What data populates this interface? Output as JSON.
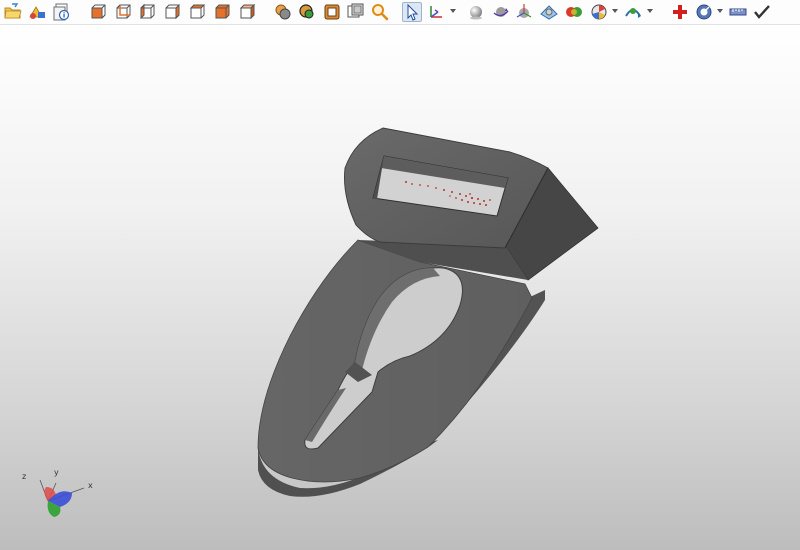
{
  "toolbar": {
    "buttons": [
      {
        "id": "open",
        "icon": "open-folder-icon"
      },
      {
        "id": "home",
        "icon": "home-shapes-icon"
      },
      {
        "id": "info",
        "icon": "info-document-icon"
      },
      {
        "id": "view-front",
        "icon": "view-front-icon"
      },
      {
        "id": "view-back",
        "icon": "view-back-icon"
      },
      {
        "id": "view-left",
        "icon": "view-left-icon"
      },
      {
        "id": "view-right",
        "icon": "view-right-icon"
      },
      {
        "id": "view-top",
        "icon": "view-top-icon"
      },
      {
        "id": "view-bottom",
        "icon": "view-bottom-icon"
      },
      {
        "id": "view-iso",
        "icon": "view-iso-icon"
      },
      {
        "id": "shaded",
        "icon": "shaded-mode-icon"
      },
      {
        "id": "shaded-edges",
        "icon": "shaded-edges-icon"
      },
      {
        "id": "wireframe",
        "icon": "wireframe-icon"
      },
      {
        "id": "hidden-line",
        "icon": "hidden-line-icon"
      },
      {
        "id": "zoom",
        "icon": "zoom-icon"
      },
      {
        "id": "select",
        "icon": "select-arrow-icon",
        "active": true
      },
      {
        "id": "axes",
        "icon": "axes-icon",
        "dropdown": true
      },
      {
        "id": "sphere",
        "icon": "sphere-icon"
      },
      {
        "id": "sphere-arrow",
        "icon": "sphere-rotate-icon"
      },
      {
        "id": "sphere-axes",
        "icon": "sphere-axes-icon"
      },
      {
        "id": "plane",
        "icon": "section-plane-icon"
      },
      {
        "id": "color",
        "icon": "color-spheres-icon"
      },
      {
        "id": "explode",
        "icon": "explode-icon",
        "dropdown": true
      },
      {
        "id": "animate",
        "icon": "animation-icon",
        "dropdown": true
      },
      {
        "id": "add",
        "icon": "red-cross-icon"
      },
      {
        "id": "settings",
        "icon": "settings-disc-icon",
        "dropdown": true
      },
      {
        "id": "measure",
        "icon": "ruler-icon"
      },
      {
        "id": "confirm",
        "icon": "checkmark-icon"
      }
    ]
  },
  "viewport": {
    "background_top": "#ffffff",
    "background_bottom": "#bdbdbd",
    "model": {
      "color": "#5c5c5c",
      "highlight_color": "#c0302a"
    }
  },
  "triad": {
    "labels": {
      "x": "x",
      "y": "y",
      "z": "z"
    },
    "colors": {
      "x": "#3a4fd6",
      "y": "#2ea12e",
      "z": "#e04a4a"
    }
  }
}
